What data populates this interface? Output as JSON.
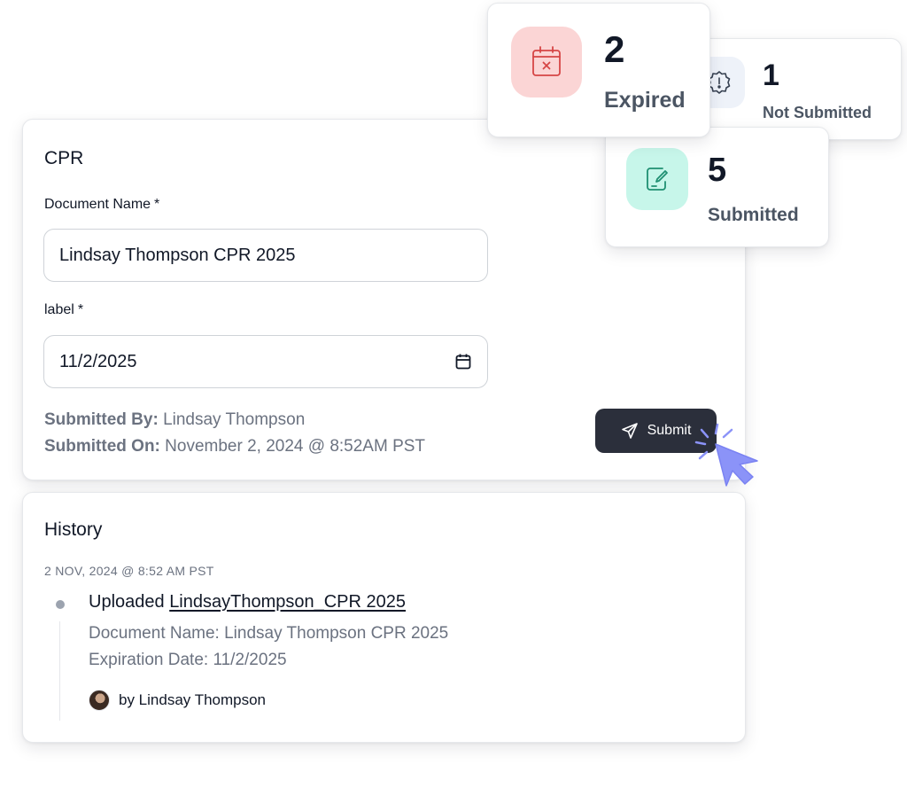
{
  "form": {
    "title": "CPR",
    "document_name_label": "Document Name",
    "document_name_value": "Lindsay Thompson CPR 2025",
    "date_label": "label",
    "date_value": "11/2/2025",
    "required_marker": "*",
    "submitted_by_label": "Submitted By:",
    "submitted_by_value": "Lindsay Thompson",
    "submitted_on_label": "Submitted On:",
    "submitted_on_value": "November 2, 2024 @ 8:52AM PST",
    "submit_label": "Submit",
    "icons": {
      "date": "calendar-icon",
      "submit": "send-icon"
    }
  },
  "history": {
    "title": "History",
    "date": "2 NOV, 2024 @  8:52 AM PST",
    "entries": [
      {
        "action": "Uploaded",
        "file": "LindsayThompson_CPR 2025",
        "document_name": "Document Name: Lindsay Thompson CPR 2025",
        "expiration": "Expiration Date: 11/2/2025",
        "by": "by Lindsay Thompson"
      }
    ]
  },
  "stats": {
    "expired": {
      "count": "2",
      "label": "Expired",
      "icon": "calendar-x-icon",
      "color": "#fbd5d5"
    },
    "not_submitted": {
      "count": "1",
      "label": "Not Submitted",
      "icon": "alert-badge-icon",
      "color": "#eef2f9"
    },
    "submitted": {
      "count": "5",
      "label": "Submitted",
      "icon": "document-edit-icon",
      "color": "#c7f6ea"
    }
  },
  "colors": {
    "button_bg": "#2b2f3b",
    "cursor": "#8b93f8",
    "expired_icon": "#d64545",
    "submitted_icon": "#1f8f72"
  }
}
